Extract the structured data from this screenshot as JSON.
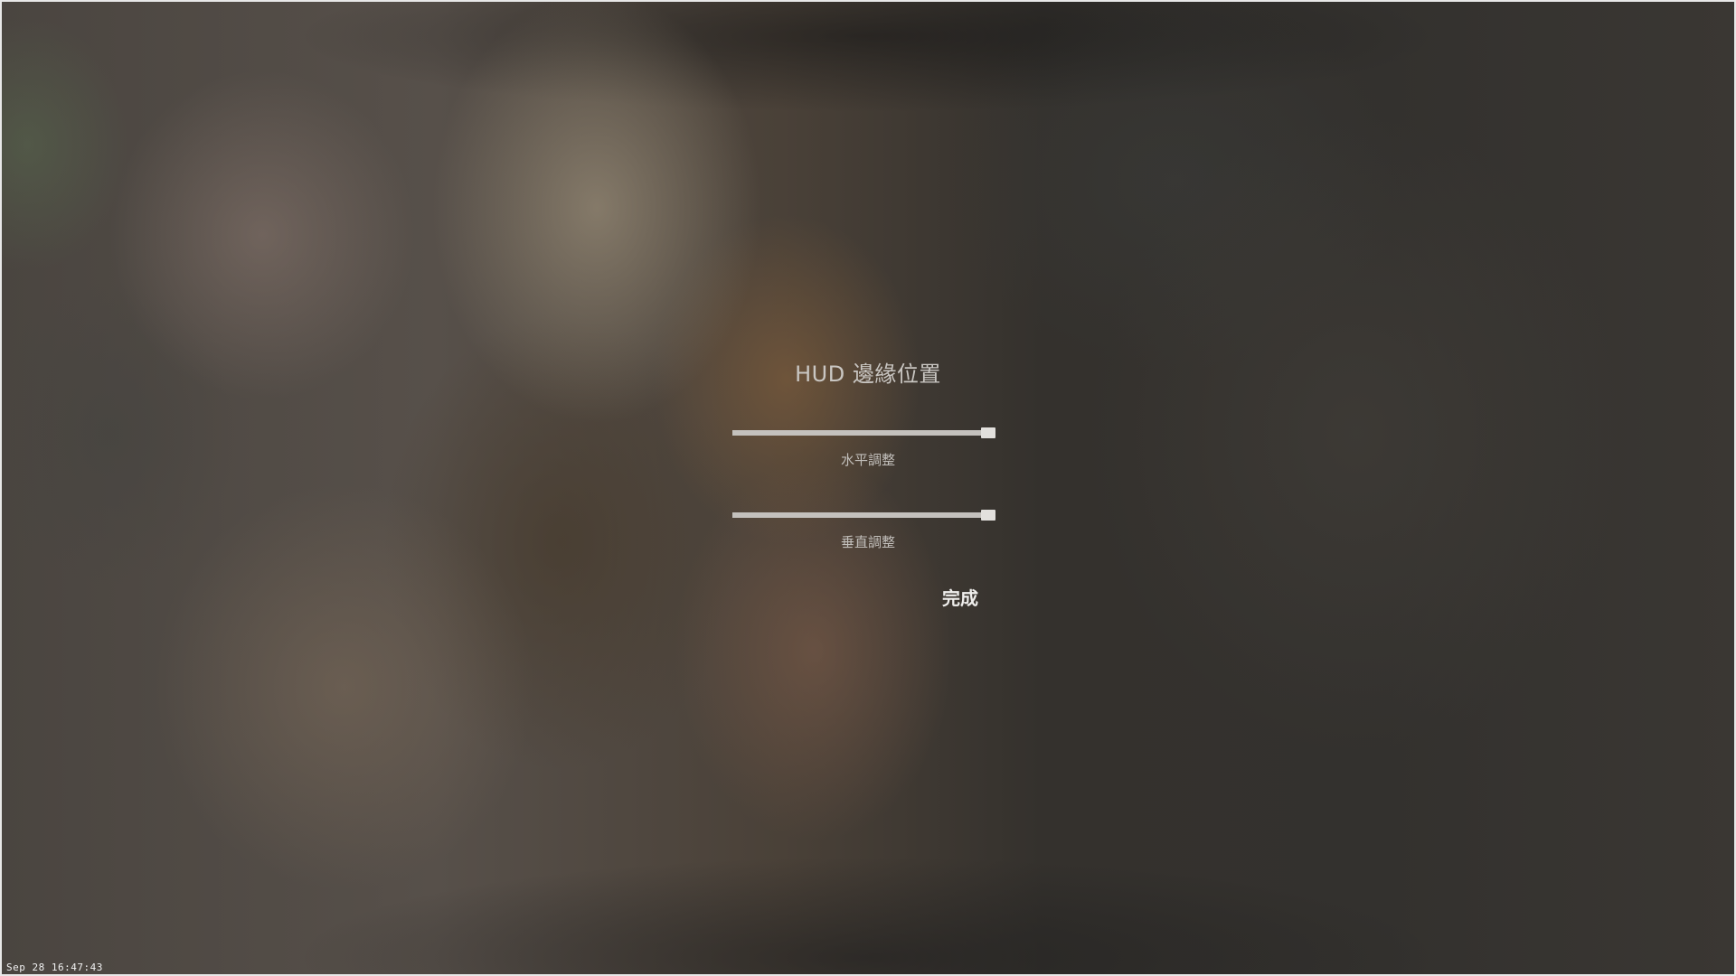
{
  "hud_settings": {
    "title": "HUD 邊緣位置",
    "horizontal": {
      "label": "水平調整",
      "value": 1.0
    },
    "vertical": {
      "label": "垂直調整",
      "value": 1.0
    },
    "done_label": "完成"
  },
  "overlay": {
    "timestamp": "Sep 28 16:47:43"
  },
  "colors": {
    "title_text": "#c9c6c2",
    "slider_track": "#b9b6b2",
    "slider_thumb": "#e2e0dd",
    "button_text": "#efeeec"
  }
}
